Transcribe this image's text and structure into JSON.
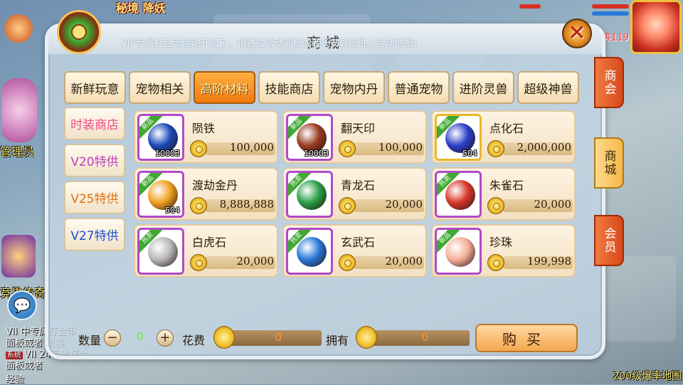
{
  "hud": {
    "top_title": "秘境 降妖",
    "left_labels": [
      "管理员",
      "竞界传奇"
    ],
    "chat_lines": [
      {
        "tag": "",
        "text": "VII 中专属打金币"
      },
      {
        "tag": "",
        "text": "面板或者 安装"
      },
      {
        "tag": "系统",
        "text": "VII 24专属打金"
      },
      {
        "tag": "",
        "text": "面板或者"
      },
      {
        "tag": "",
        "text": "经验"
      }
    ],
    "chat_tag_label": "系统",
    "bottom_map": "200级爆率地图",
    "player_level": "等119",
    "chat_icon": "chat-bubble-icon"
  },
  "shop": {
    "title": "商城",
    "marquee": "VIP专属打金币活动开启了，请通过活动面板或者长安城仙进入活动地图！",
    "close_icon": "close-x-icon",
    "tabs": [
      "新鲜玩意",
      "宠物相关",
      "高阶材料",
      "技能商店",
      "宠物内丹",
      "普通宠物",
      "进阶灵兽",
      "超级神兽"
    ],
    "active_tab": 2,
    "subtabs": [
      {
        "label": "时装商店",
        "color": "#f04a8a"
      },
      {
        "label": "V20特供",
        "color": "#c040c0"
      },
      {
        "label": "V25特供",
        "color": "#e07010"
      },
      {
        "label": "V27特供",
        "color": "#1a50d0"
      }
    ],
    "side_tabs": [
      {
        "label": "商会",
        "style": "red"
      },
      {
        "label": "商城",
        "style": "gold"
      },
      {
        "label": "会员",
        "style": "red"
      }
    ],
    "items": [
      {
        "name": "陨铁",
        "price": "100,000",
        "badge": "新品",
        "count": "10003",
        "frame": "purple",
        "art": "#1a4ab8"
      },
      {
        "name": "翻天印",
        "price": "100,000",
        "badge": "新品",
        "count": "10003",
        "frame": "purple",
        "art": "#9a3a20"
      },
      {
        "name": "点化石",
        "price": "2,000,000",
        "badge": "新品",
        "count": "504",
        "frame": "gold",
        "art": "#2a40c8"
      },
      {
        "name": "渡劫金丹",
        "price": "8,888,888",
        "badge": "新品",
        "count": "504",
        "frame": "purple",
        "art": "#f0a020"
      },
      {
        "name": "青龙石",
        "price": "20,000",
        "badge": "热卖",
        "count": "",
        "frame": "purple",
        "art": "#2aa048"
      },
      {
        "name": "朱雀石",
        "price": "20,000",
        "badge": "热卖",
        "count": "",
        "frame": "purple",
        "art": "#d8382a"
      },
      {
        "name": "白虎石",
        "price": "20,000",
        "badge": "热卖",
        "count": "",
        "frame": "purple",
        "art": "#b8b8b8"
      },
      {
        "name": "玄武石",
        "price": "20,000",
        "badge": "热卖",
        "count": "",
        "frame": "purple",
        "art": "#2a78d8"
      },
      {
        "name": "珍珠",
        "price": "199,998",
        "badge": "新品",
        "count": "",
        "frame": "purple",
        "art": "#f6b09a"
      }
    ],
    "bottom": {
      "qty_label": "数量",
      "qty_value": "0",
      "minus": "−",
      "plus": "+",
      "cost_label": "花费",
      "cost_value": "0",
      "owned_label": "拥有",
      "owned_value": "0",
      "buy_label": "购买"
    }
  }
}
